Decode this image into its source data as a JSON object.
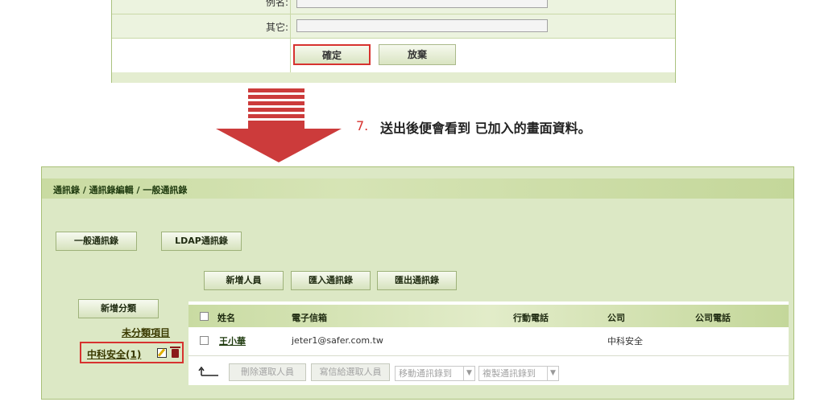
{
  "form": {
    "alias_label": "例名:",
    "other_label": "其它:",
    "confirm_label": "確定",
    "cancel_label": "放棄"
  },
  "instruction": {
    "step": "7.",
    "text": "送出後便會看到 已加入的畫面資料。"
  },
  "breadcrumb": "通訊錄 / 通訊錄編輯 / 一般通訊錄",
  "tabs": {
    "general": "一般通訊錄",
    "ldap": "LDAP通訊錄"
  },
  "actions": {
    "add_member": "新增人員",
    "import": "匯入通訊錄",
    "export": "匯出通訊錄"
  },
  "sidebar": {
    "add_category": "新增分類",
    "uncategorized": "未分類項目",
    "category": "中科安全(1)"
  },
  "table": {
    "headers": {
      "name": "姓名",
      "email": "電子信箱",
      "mobile": "行動電話",
      "company": "公司",
      "company_phone": "公司電話"
    },
    "rows": [
      {
        "name": "王小華",
        "email": "jeter1@safer.com.tw",
        "mobile": "",
        "company": "中科安全",
        "company_phone": ""
      }
    ]
  },
  "bulk": {
    "delete_selected": "刪除選取人員",
    "mail_selected": "寫信給選取人員",
    "move_to": "移動通訊錄到",
    "copy_to": "複製通訊錄到"
  },
  "colors": {
    "accent": "#d7322f",
    "panel": "#dce8c5",
    "header_bar": "#c9dba2"
  }
}
